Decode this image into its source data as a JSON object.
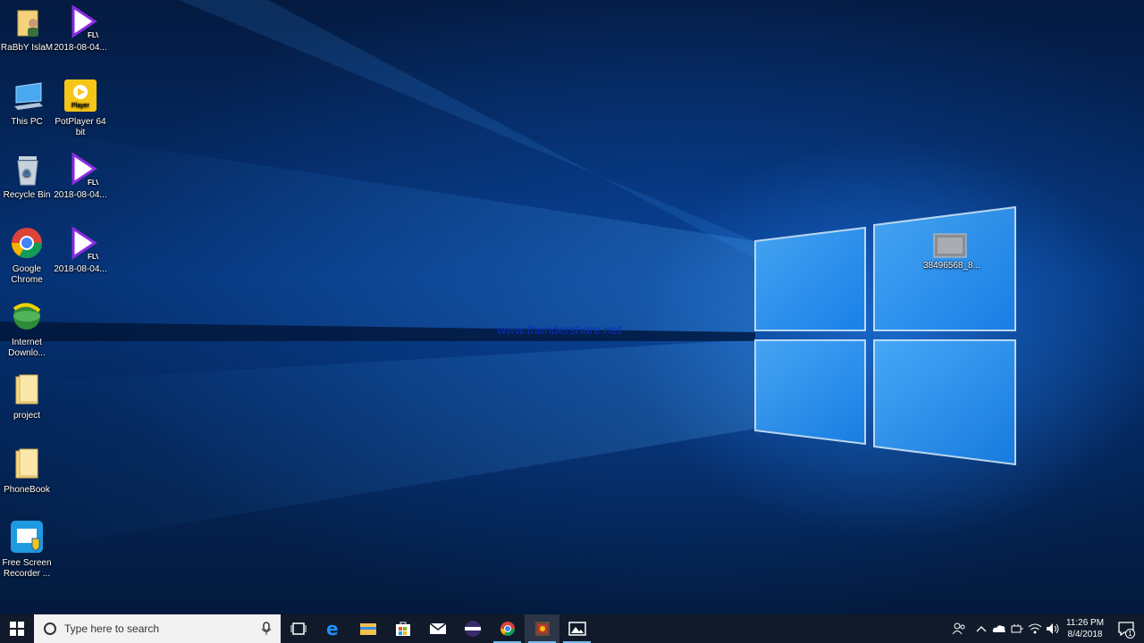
{
  "desktop": {
    "icons": [
      {
        "label": "RaBbY IslaM",
        "icon": "user-folder-icon"
      },
      {
        "label": "2018-08-04...",
        "icon": "flv-video-icon",
        "badge": "FLV"
      },
      {
        "label": "This PC",
        "icon": "computer-icon"
      },
      {
        "label": "PotPlayer 64 bit",
        "icon": "potplayer-icon",
        "badge": "Player"
      },
      {
        "label": "Recycle Bin",
        "icon": "recycle-bin-icon"
      },
      {
        "label": "2018-08-04...",
        "icon": "flv-video-icon",
        "badge": "FLV"
      },
      {
        "label": "Google Chrome",
        "icon": "chrome-icon"
      },
      {
        "label": "2018-08-04...",
        "icon": "flv-video-icon",
        "badge": "FLV"
      },
      {
        "label": "Internet Downlo...",
        "icon": "idm-icon"
      },
      {
        "label": "project",
        "icon": "folder-icon"
      },
      {
        "label": "PhoneBook",
        "icon": "folder-icon"
      },
      {
        "label": "Free Screen Recorder ...",
        "icon": "screen-recorder-icon"
      },
      {
        "label": "38496568_8...",
        "icon": "image-file-icon"
      }
    ],
    "watermark": "www.thundershare.net"
  },
  "taskbar": {
    "search_placeholder": "Type here to search",
    "apps": [
      {
        "name": "task-view",
        "icon": "task-view-icon"
      },
      {
        "name": "edge",
        "icon": "edge-icon"
      },
      {
        "name": "file-explorer",
        "icon": "file-explorer-icon"
      },
      {
        "name": "store",
        "icon": "store-icon"
      },
      {
        "name": "mail",
        "icon": "mail-icon"
      },
      {
        "name": "app",
        "icon": "eclipse-icon"
      },
      {
        "name": "chrome",
        "icon": "chrome-icon",
        "active": true
      },
      {
        "name": "recorder",
        "icon": "recorder-app-icon",
        "active": true
      },
      {
        "name": "photos",
        "icon": "photos-icon",
        "active": true
      }
    ],
    "clock": {
      "time": "11:26 PM",
      "date": "8/4/2018"
    },
    "notification_count": "1"
  },
  "colors": {
    "accent": "#76b9ed",
    "taskbar": "#101a2a",
    "watermark": "#0a2fb8"
  }
}
